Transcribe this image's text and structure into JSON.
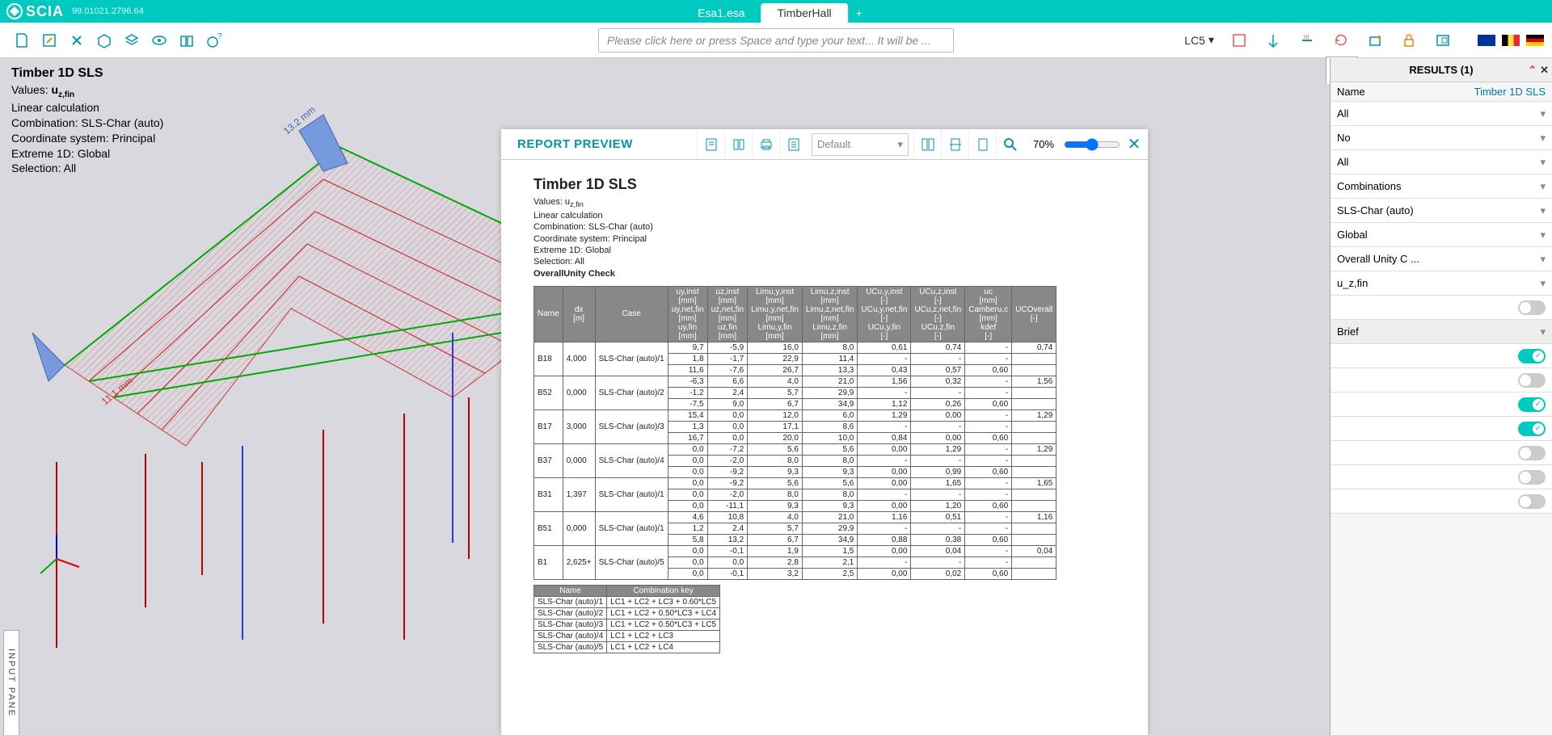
{
  "app": {
    "name": "SCIA",
    "version": "99.01021.2796.64"
  },
  "tabs": {
    "items": [
      "Esa1.esa",
      "TimberHall"
    ],
    "active": 1
  },
  "commandline": {
    "placeholder": "Please click here or press Space and type your text... It will be ..."
  },
  "lc": {
    "label": "LC5"
  },
  "overlay": {
    "title": "Timber 1D SLS",
    "lines": [
      "Values: ",
      "Linear calculation",
      "Combination: SLS-Char (auto)",
      "Coordinate system: Principal",
      "Extreme 1D: Global",
      "Selection: All"
    ],
    "values_sub": "u",
    "values_subscript": "z,fin"
  },
  "report": {
    "panel_title": "REPORT PREVIEW",
    "template": "Default",
    "zoom": "70%",
    "doc_title": "Timber 1D SLS",
    "meta": [
      "Values: u",
      "Linear calculation",
      "Combination: SLS-Char (auto)",
      "Coordinate system: Principal",
      "Extreme 1D: Global",
      "Selection: All",
      "OverallUnity Check"
    ],
    "meta_sub": "z,fin",
    "headers": [
      "Name",
      "dx\n[m]",
      "Case",
      "uy,inst\n[mm]\nuy,net,fin\n[mm]\nuy,fin\n[mm]",
      "uz,inst\n[mm]\nuz,net,fin\n[mm]\nuz,fin\n[mm]",
      "Limu,y,inst\n[mm]\nLimu,y,net,fin\n[mm]\nLimu,y,fin\n[mm]",
      "Limu,z,inst\n[mm]\nLimu,z,net,fin\n[mm]\nLimu,z,fin\n[mm]",
      "UCu,y,inst\n[-]\nUCu,y,net,fin\n[-]\nUCu,y,fin\n[-]",
      "UCu,z,inst\n[-]\nUCu,z,net,fin\n[-]\nUCu,z,fin\n[-]",
      "uc\n[mm]\nCamberu,c\n[mm]\nkdef\n[-]",
      "UCOverall\n[-]"
    ],
    "rows": [
      {
        "name": "B18",
        "dx": "4,000",
        "case": "SLS-Char (auto)/1",
        "c": [
          [
            "9,7",
            "1,8",
            "11,6"
          ],
          [
            "-5,9",
            "-1,7",
            "-7,6"
          ],
          [
            "16,0",
            "22,9",
            "26,7"
          ],
          [
            "8,0",
            "11,4",
            "13,3"
          ],
          [
            "0,61",
            "-",
            "0,43"
          ],
          [
            "0,74",
            "-",
            "0,57"
          ],
          [
            "-",
            "-",
            "0,60"
          ],
          [
            "0,74",
            "",
            ""
          ]
        ]
      },
      {
        "name": "B52",
        "dx": "0,000",
        "case": "SLS-Char (auto)/2",
        "c": [
          [
            "-6,3",
            "-1,2",
            "-7,5"
          ],
          [
            "6,6",
            "2,4",
            "9,0"
          ],
          [
            "4,0",
            "5,7",
            "6,7"
          ],
          [
            "21,0",
            "29,9",
            "34,9"
          ],
          [
            "1,56",
            "-",
            "1,12"
          ],
          [
            "0,32",
            "-",
            "0,26"
          ],
          [
            "-",
            "-",
            "0,60"
          ],
          [
            "1,56",
            "",
            ""
          ]
        ]
      },
      {
        "name": "B17",
        "dx": "3,000",
        "case": "SLS-Char (auto)/3",
        "c": [
          [
            "15,4",
            "1,3",
            "16,7"
          ],
          [
            "0,0",
            "0,0",
            "0,0"
          ],
          [
            "12,0",
            "17,1",
            "20,0"
          ],
          [
            "6,0",
            "8,6",
            "10,0"
          ],
          [
            "1,29",
            "-",
            "0,84"
          ],
          [
            "0,00",
            "-",
            "0,00"
          ],
          [
            "-",
            "-",
            "0,60"
          ],
          [
            "1,29",
            "",
            ""
          ]
        ]
      },
      {
        "name": "B37",
        "dx": "0,000",
        "case": "SLS-Char (auto)/4",
        "c": [
          [
            "0,0",
            "0,0",
            "0,0"
          ],
          [
            "-7,2",
            "-2,0",
            "-9,2"
          ],
          [
            "5,6",
            "8,0",
            "9,3"
          ],
          [
            "5,6",
            "8,0",
            "9,3"
          ],
          [
            "0,00",
            "-",
            "0,00"
          ],
          [
            "1,29",
            "-",
            "0,99"
          ],
          [
            "-",
            "-",
            "0,60"
          ],
          [
            "1,29",
            "",
            ""
          ]
        ]
      },
      {
        "name": "B31",
        "dx": "1,397",
        "case": "SLS-Char (auto)/1",
        "c": [
          [
            "0,0",
            "0,0",
            "0,0"
          ],
          [
            "-9,2",
            "-2,0",
            "-11,1"
          ],
          [
            "5,6",
            "8,0",
            "9,3"
          ],
          [
            "5,6",
            "8,0",
            "9,3"
          ],
          [
            "0,00",
            "-",
            "0,00"
          ],
          [
            "1,65",
            "-",
            "1,20"
          ],
          [
            "-",
            "-",
            "0,60"
          ],
          [
            "1,65",
            "",
            ""
          ]
        ]
      },
      {
        "name": "B51",
        "dx": "0,000",
        "case": "SLS-Char (auto)/1",
        "c": [
          [
            "4,6",
            "1,2",
            "5,8"
          ],
          [
            "10,8",
            "2,4",
            "13,2"
          ],
          [
            "4,0",
            "5,7",
            "6,7"
          ],
          [
            "21,0",
            "29,9",
            "34,9"
          ],
          [
            "1,16",
            "-",
            "0,88"
          ],
          [
            "0,51",
            "-",
            "0,38"
          ],
          [
            "-",
            "-",
            "0,60"
          ],
          [
            "1,16",
            "",
            ""
          ]
        ]
      },
      {
        "name": "B1",
        "dx": "2,625+",
        "case": "SLS-Char (auto)/5",
        "c": [
          [
            "0,0",
            "0,0",
            "0,0"
          ],
          [
            "-0,1",
            "0,0",
            "-0,1"
          ],
          [
            "1,9",
            "2,8",
            "3,2"
          ],
          [
            "1,5",
            "2,1",
            "2,5"
          ],
          [
            "0,00",
            "-",
            "0,00"
          ],
          [
            "0,04",
            "-",
            "0,02"
          ],
          [
            "-",
            "-",
            "0,60"
          ],
          [
            "0,04",
            "",
            ""
          ]
        ]
      }
    ],
    "combo_header": [
      "Name",
      "Combination key"
    ],
    "combos": [
      [
        "SLS-Char (auto)/1",
        "LC1 + LC2 + LC3 + 0.60*LC5"
      ],
      [
        "SLS-Char (auto)/2",
        "LC1 + LC2 + 0.50*LC3 + LC4"
      ],
      [
        "SLS-Char (auto)/3",
        "LC1 + LC2 + 0.50*LC3 + LC5"
      ],
      [
        "SLS-Char (auto)/4",
        "LC1 + LC2 + LC3"
      ],
      [
        "SLS-Char (auto)/5",
        "LC1 + LC2 + LC4"
      ]
    ]
  },
  "results": {
    "title": "RESULTS (1)",
    "name_label": "Name",
    "name_value": "Timber 1D SLS",
    "props": [
      {
        "label": "All",
        "type": "select"
      },
      {
        "label": "No",
        "type": "select"
      },
      {
        "label": "All",
        "type": "select"
      },
      {
        "label": "Combinations",
        "type": "select"
      },
      {
        "label": "SLS-Char (auto)",
        "type": "select"
      },
      {
        "label": "Global",
        "type": "select"
      },
      {
        "label": "Overall Unity C ...",
        "type": "select"
      },
      {
        "label": "u_z,fin",
        "type": "select"
      },
      {
        "label": "",
        "type": "toggle",
        "on": false
      },
      {
        "label": "Brief",
        "type": "select",
        "gray": true
      },
      {
        "label": "",
        "type": "toggle",
        "on": true
      },
      {
        "label": "",
        "type": "toggle",
        "on": false
      },
      {
        "label": "",
        "type": "toggle",
        "on": true
      },
      {
        "label": "",
        "type": "toggle",
        "on": true
      },
      {
        "label": "",
        "type": "toggle",
        "on": false
      },
      {
        "label": "",
        "type": "toggle",
        "on": false
      },
      {
        "label": "",
        "type": "toggle",
        "on": false
      }
    ]
  },
  "input_panel": {
    "label": "INPUT PANE"
  }
}
